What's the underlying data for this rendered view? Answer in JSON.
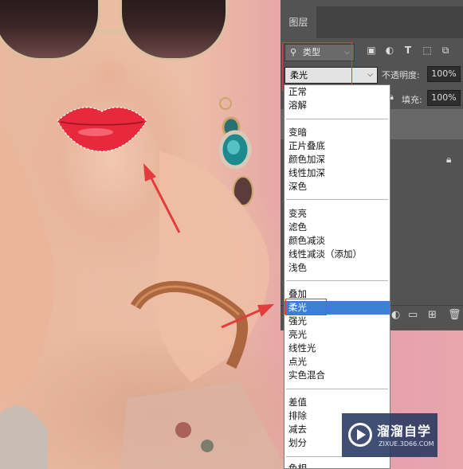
{
  "layers_panel": {
    "tab_label": "图层",
    "filter_label": "类型",
    "blend_mode": "柔光",
    "opacity_label": "不透明度:",
    "opacity_value": "100%",
    "fill_label": "填充:",
    "fill_value": "100%"
  },
  "blend_menu": {
    "items": [
      "正常",
      "溶解",
      "变暗",
      "正片叠底",
      "颜色加深",
      "线性加深",
      "深色",
      "变亮",
      "滤色",
      "颜色减淡",
      "线性减淡（添加）",
      "浅色",
      "叠加",
      "柔光",
      "强光",
      "亮光",
      "线性光",
      "点光",
      "实色混合",
      "差值",
      "排除",
      "减去",
      "划分",
      "色相"
    ],
    "selected": "柔光"
  },
  "watermark": {
    "title": "溜溜自学",
    "url": "ZIXUE.3D66.COM"
  },
  "colors": {
    "panel_bg": "#535353",
    "menu_selected": "#3d7fd8",
    "annotation_red": "#e23c3c",
    "lips_red": "#e8283c"
  },
  "icons": [
    "search-icon",
    "image-filter-icon",
    "adjustment-filter-icon",
    "type-filter-icon",
    "shape-filter-icon",
    "smart-object-filter-icon",
    "lock-icon",
    "folder-icon",
    "new-layer-icon",
    "trash-icon",
    "watermark-play-icon",
    "arrow-annotation-icon"
  ]
}
